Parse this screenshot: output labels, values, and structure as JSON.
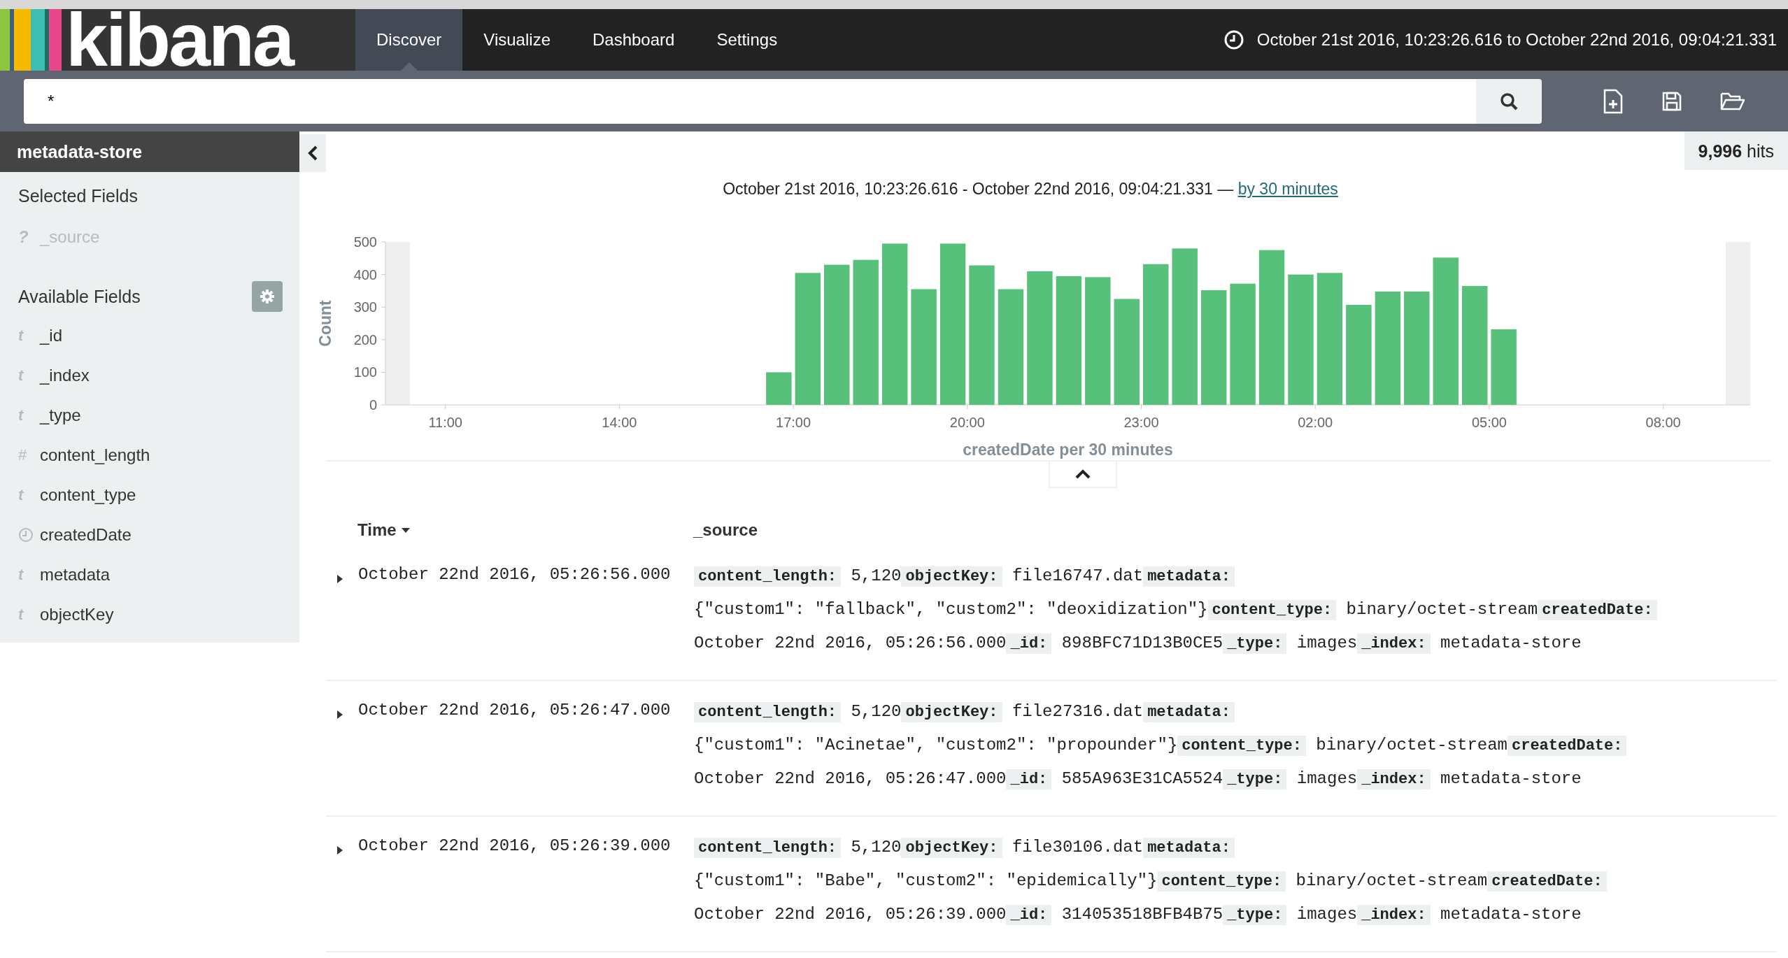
{
  "nav": {
    "logo": "kibana",
    "tabs": [
      {
        "label": "Discover",
        "selected": true
      },
      {
        "label": "Visualize",
        "selected": false
      },
      {
        "label": "Dashboard",
        "selected": false
      },
      {
        "label": "Settings",
        "selected": false
      }
    ],
    "time_range": "October 21st 2016, 10:23:26.616 to October 22nd 2016, 09:04:21.331"
  },
  "search": {
    "value": "*"
  },
  "sidebar": {
    "index": "metadata-store",
    "selected_title": "Selected Fields",
    "selected_fields": [
      {
        "kind": "unknown",
        "icon": "?",
        "name": "_source",
        "muted": true
      }
    ],
    "available_title": "Available Fields",
    "available_fields": [
      {
        "kind": "string",
        "icon": "t",
        "name": "_id",
        "muted": false
      },
      {
        "kind": "string",
        "icon": "t",
        "name": "_index",
        "muted": false
      },
      {
        "kind": "string",
        "icon": "t",
        "name": "_type",
        "muted": false
      },
      {
        "kind": "number",
        "icon": "#",
        "name": "content_length",
        "muted": false
      },
      {
        "kind": "string",
        "icon": "t",
        "name": "content_type",
        "muted": false
      },
      {
        "kind": "date",
        "name": "createdDate",
        "muted": false
      },
      {
        "kind": "string",
        "icon": "t",
        "name": "metadata",
        "muted": false
      },
      {
        "kind": "string",
        "icon": "t",
        "name": "objectKey",
        "muted": false
      }
    ]
  },
  "hits": "**9,996** hits",
  "histogram": {
    "range_text": "October 21st 2016, 10:23:26.616 - October 22nd 2016, 09:04:21.331 —",
    "interval_link": "by 30 minutes",
    "chart_data": {
      "type": "bar",
      "xlabel": "createdDate per 30 minutes",
      "ylabel": "Count",
      "x": [
        "2016-10-21T16:45",
        "2016-10-21T17:15",
        "2016-10-21T17:45",
        "2016-10-21T18:15",
        "2016-10-21T18:45",
        "2016-10-21T19:15",
        "2016-10-21T19:45",
        "2016-10-21T20:15",
        "2016-10-21T20:45",
        "2016-10-21T21:15",
        "2016-10-21T21:45",
        "2016-10-21T22:15",
        "2016-10-21T22:45",
        "2016-10-21T23:15",
        "2016-10-21T23:45",
        "2016-10-22T00:15",
        "2016-10-22T00:45",
        "2016-10-22T01:15",
        "2016-10-22T01:45",
        "2016-10-22T02:15",
        "2016-10-22T02:45",
        "2016-10-22T03:15",
        "2016-10-22T03:45",
        "2016-10-22T04:15",
        "2016-10-22T04:45",
        "2016-10-22T05:15"
      ],
      "values": [
        100,
        405,
        430,
        445,
        495,
        355,
        495,
        428,
        355,
        410,
        395,
        392,
        325,
        432,
        480,
        352,
        372,
        475,
        400,
        405,
        307,
        348,
        348,
        452,
        365,
        232
      ],
      "xlim": [
        "2016-10-21T09:58",
        "2016-10-22T09:30"
      ],
      "ylim": [
        0,
        500
      ],
      "xticks": [
        {
          "value": "2016-10-21T11:00",
          "label": "11:00"
        },
        {
          "value": "2016-10-21T14:00",
          "label": "14:00"
        },
        {
          "value": "2016-10-21T17:00",
          "label": "17:00"
        },
        {
          "value": "2016-10-21T20:00",
          "label": "20:00"
        },
        {
          "value": "2016-10-21T23:00",
          "label": "23:00"
        },
        {
          "value": "2016-10-22T02:00",
          "label": "02:00"
        },
        {
          "value": "2016-10-22T05:00",
          "label": "05:00"
        },
        {
          "value": "2016-10-22T08:00",
          "label": "08:00"
        }
      ],
      "yticks": [
        0,
        100,
        200,
        300,
        400,
        500
      ]
    }
  },
  "table": {
    "columns": [
      "Time",
      "_source"
    ],
    "rows": [
      {
        "time": "October 22nd 2016, 05:26:56.000",
        "source": [
          {
            "key": "content_length:",
            "value": "5,120"
          },
          {
            "key": "objectKey:",
            "value": "file16747.dat"
          },
          {
            "key": "metadata:",
            "value": "{\"custom1\": \"fallback\", \"custom2\": \"deoxidization\"}"
          },
          {
            "key": "content_type:",
            "value": "binary/octet-stream"
          },
          {
            "key": "createdDate:",
            "value": "October 22nd 2016, 05:26:56.000"
          },
          {
            "key": "_id:",
            "value": "898BFC71D13B0CE5"
          },
          {
            "key": "_type:",
            "value": "images"
          },
          {
            "key": "_index:",
            "value": "metadata-store"
          }
        ]
      },
      {
        "time": "October 22nd 2016, 05:26:47.000",
        "source": [
          {
            "key": "content_length:",
            "value": "5,120"
          },
          {
            "key": "objectKey:",
            "value": "file27316.dat"
          },
          {
            "key": "metadata:",
            "value": "{\"custom1\": \"Acinetae\", \"custom2\": \"propounder\"}"
          },
          {
            "key": "content_type:",
            "value": "binary/octet-stream"
          },
          {
            "key": "createdDate:",
            "value": "October 22nd 2016, 05:26:47.000"
          },
          {
            "key": "_id:",
            "value": "585A963E31CA5524"
          },
          {
            "key": "_type:",
            "value": "images"
          },
          {
            "key": "_index:",
            "value": "metadata-store"
          }
        ]
      },
      {
        "time": "October 22nd 2016, 05:26:39.000",
        "source": [
          {
            "key": "content_length:",
            "value": "5,120"
          },
          {
            "key": "objectKey:",
            "value": "file30106.dat"
          },
          {
            "key": "metadata:",
            "value": "{\"custom1\": \"Babe\", \"custom2\": \"epidemically\"}"
          },
          {
            "key": "content_type:",
            "value": "binary/octet-stream"
          },
          {
            "key": "createdDate:",
            "value": "October 22nd 2016, 05:26:39.000"
          },
          {
            "key": "_id:",
            "value": "314053518BFB4B75"
          },
          {
            "key": "_type:",
            "value": "images"
          },
          {
            "key": "_index:",
            "value": "metadata-store"
          }
        ]
      }
    ]
  }
}
